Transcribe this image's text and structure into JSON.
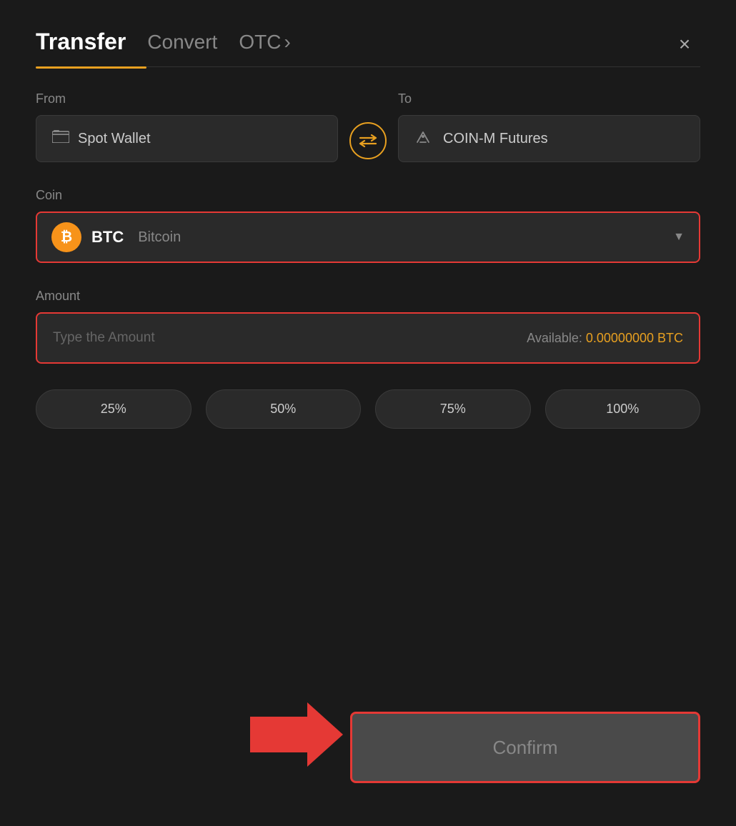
{
  "header": {
    "tab_transfer": "Transfer",
    "tab_convert": "Convert",
    "tab_otc": "OTC",
    "otc_arrow": "›",
    "close_icon": "×"
  },
  "from": {
    "label": "From",
    "wallet_label": "Spot Wallet"
  },
  "to": {
    "label": "To",
    "wallet_label": "COIN-M Futures"
  },
  "coin": {
    "label": "Coin",
    "symbol": "BTC",
    "name": "Bitcoin",
    "btc_char": "₿"
  },
  "amount": {
    "label": "Amount",
    "placeholder": "Type the Amount",
    "available_label": "Available:",
    "available_value": "0.00000000 BTC"
  },
  "percent_buttons": [
    {
      "label": "25%"
    },
    {
      "label": "50%"
    },
    {
      "label": "75%"
    },
    {
      "label": "100%"
    }
  ],
  "confirm_button": {
    "label": "Confirm"
  }
}
